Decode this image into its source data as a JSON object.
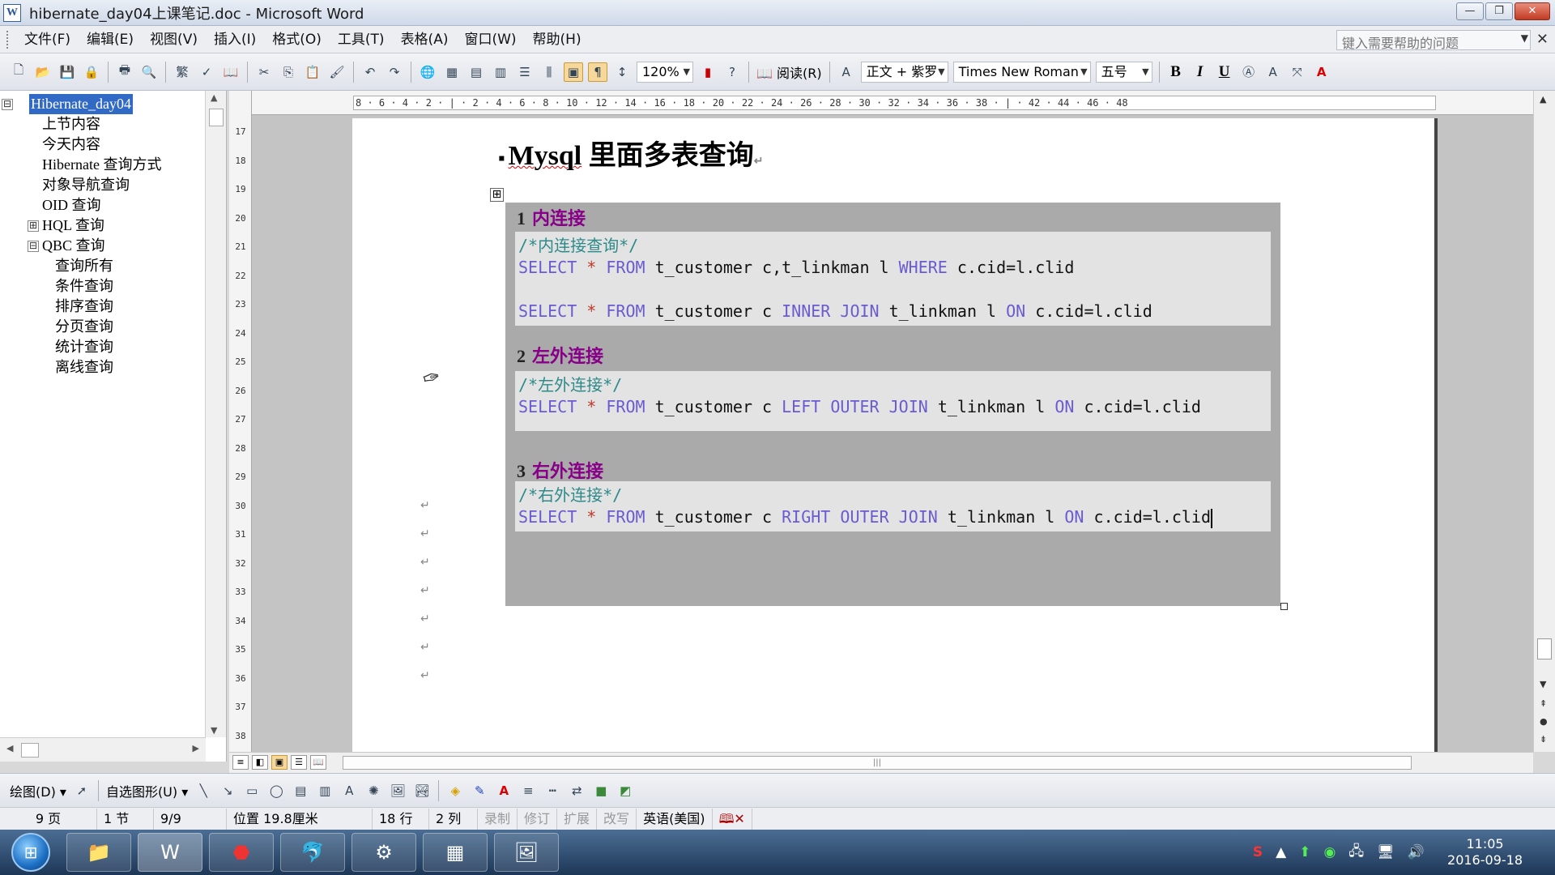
{
  "window": {
    "title": "hibernate_day04上课笔记.doc - Microsoft Word",
    "app_icon_letter": "W"
  },
  "menu": {
    "items": [
      "文件(F)",
      "编辑(E)",
      "视图(V)",
      "插入(I)",
      "格式(O)",
      "工具(T)",
      "表格(A)",
      "窗口(W)",
      "帮助(H)"
    ],
    "help_placeholder": "键入需要帮助的问题"
  },
  "toolbar": {
    "zoom": "120%",
    "read_label": "阅读(R)",
    "style": "正文 + 紫罗",
    "font": "Times New Roman",
    "size": "五号",
    "bold": "B",
    "italic": "I",
    "underline": "U"
  },
  "docmap": {
    "items": [
      {
        "label": "Hibernate_day04",
        "level": 0,
        "toggle": "⊟",
        "selected": true
      },
      {
        "label": "上节内容",
        "level": 1,
        "toggle": ""
      },
      {
        "label": "今天内容",
        "level": 1,
        "toggle": ""
      },
      {
        "label": "Hibernate 查询方式",
        "level": 1,
        "toggle": ""
      },
      {
        "label": "对象导航查询",
        "level": 1,
        "toggle": ""
      },
      {
        "label": "OID 查询",
        "level": 1,
        "toggle": ""
      },
      {
        "label": "HQL 查询",
        "level": 1,
        "toggle": "⊞"
      },
      {
        "label": "QBC 查询",
        "level": 1,
        "toggle": "⊟"
      },
      {
        "label": "查询所有",
        "level": 2,
        "toggle": ""
      },
      {
        "label": "条件查询",
        "level": 2,
        "toggle": ""
      },
      {
        "label": "排序查询",
        "level": 2,
        "toggle": ""
      },
      {
        "label": "分页查询",
        "level": 2,
        "toggle": ""
      },
      {
        "label": "统计查询",
        "level": 2,
        "toggle": ""
      },
      {
        "label": "离线查询",
        "level": 2,
        "toggle": ""
      }
    ]
  },
  "ruler": {
    "text": "8 · 6 · 4 · 2 · | · 2 · 4 · 6 · 8 · 10 · 12 · 14 · 16 · 18 · 20 · 22 · 24 · 26 · 28 · 30 · 32 · 34 · 36 · 38 · | · 42 · 44 · 46 · 48",
    "vertical_numbers": [
      "17",
      "18",
      "19",
      "20",
      "21",
      "22",
      "23",
      "24",
      "25",
      "26",
      "27",
      "28",
      "29",
      "30",
      "31",
      "32",
      "33",
      "34",
      "35",
      "36",
      "37",
      "38"
    ]
  },
  "document": {
    "heading_bullet": "▪",
    "heading_word": "Mysql",
    "heading_rest": "里面多表查询",
    "sections": [
      {
        "num": "1",
        "title": "内连接",
        "comment": "/*内连接查询*/",
        "lines": [
          [
            [
              "kw",
              "SELECT"
            ],
            [
              "t",
              " "
            ],
            [
              "op",
              "*"
            ],
            [
              "t",
              " "
            ],
            [
              "kw",
              "FROM"
            ],
            [
              "t",
              " t_customer c,t_linkman l "
            ],
            [
              "kw",
              "WHERE"
            ],
            [
              "t",
              " c.cid=l.clid"
            ]
          ],
          [],
          [
            [
              "kw",
              "SELECT"
            ],
            [
              "t",
              " "
            ],
            [
              "op",
              "*"
            ],
            [
              "t",
              " "
            ],
            [
              "kw",
              "FROM"
            ],
            [
              "t",
              " t_customer c "
            ],
            [
              "kw",
              "INNER"
            ],
            [
              "t",
              " "
            ],
            [
              "kw",
              "JOIN"
            ],
            [
              "t",
              " t_linkman l "
            ],
            [
              "kw",
              "ON"
            ],
            [
              "t",
              " c.cid=l.clid"
            ]
          ]
        ]
      },
      {
        "num": "2",
        "title": "左外连接",
        "comment": "/*左外连接*/",
        "lines": [
          [
            [
              "kw",
              "SELECT"
            ],
            [
              "t",
              " "
            ],
            [
              "op",
              "*"
            ],
            [
              "t",
              " "
            ],
            [
              "kw",
              "FROM"
            ],
            [
              "t",
              " t_customer c "
            ],
            [
              "kw",
              "LEFT"
            ],
            [
              "t",
              " "
            ],
            [
              "kw",
              "OUTER"
            ],
            [
              "t",
              " "
            ],
            [
              "kw",
              "JOIN"
            ],
            [
              "t",
              " t_linkman l "
            ],
            [
              "kw",
              "ON"
            ],
            [
              "t",
              " c.cid=l.clid"
            ]
          ]
        ]
      },
      {
        "num": "3",
        "title": "右外连接",
        "comment": "/*右外连接*/",
        "lines": [
          [
            [
              "kw",
              "SELECT"
            ],
            [
              "t",
              " "
            ],
            [
              "op",
              "*"
            ],
            [
              "t",
              " "
            ],
            [
              "kw",
              "FROM"
            ],
            [
              "t",
              " t_customer c "
            ],
            [
              "kw",
              "RIGHT"
            ],
            [
              "t",
              " "
            ],
            [
              "kw",
              "OUTER"
            ],
            [
              "t",
              " "
            ],
            [
              "kw",
              "JOIN"
            ],
            [
              "t",
              " t_linkman l "
            ],
            [
              "kw",
              "ON"
            ],
            [
              "t",
              " c.cid=l.clid"
            ]
          ]
        ]
      }
    ]
  },
  "drawbar": {
    "draw_label": "绘图(D)",
    "autoshape_label": "自选图形(U)"
  },
  "status": {
    "page": "9 页",
    "section": "1 节",
    "pages": "9/9",
    "position": "位置 19.8厘米",
    "line": "18 行",
    "col": "2 列",
    "rec": "录制",
    "trk": "修订",
    "ext": "扩展",
    "ovr": "改写",
    "lang": "英语(美国)"
  },
  "taskbar": {
    "time": "11:05",
    "date": "2016-09-18"
  },
  "colors": {
    "keyword": "#6a5bd0",
    "comment": "#2e8a8a",
    "section_title": "#880088",
    "selection": "#316ac5"
  }
}
